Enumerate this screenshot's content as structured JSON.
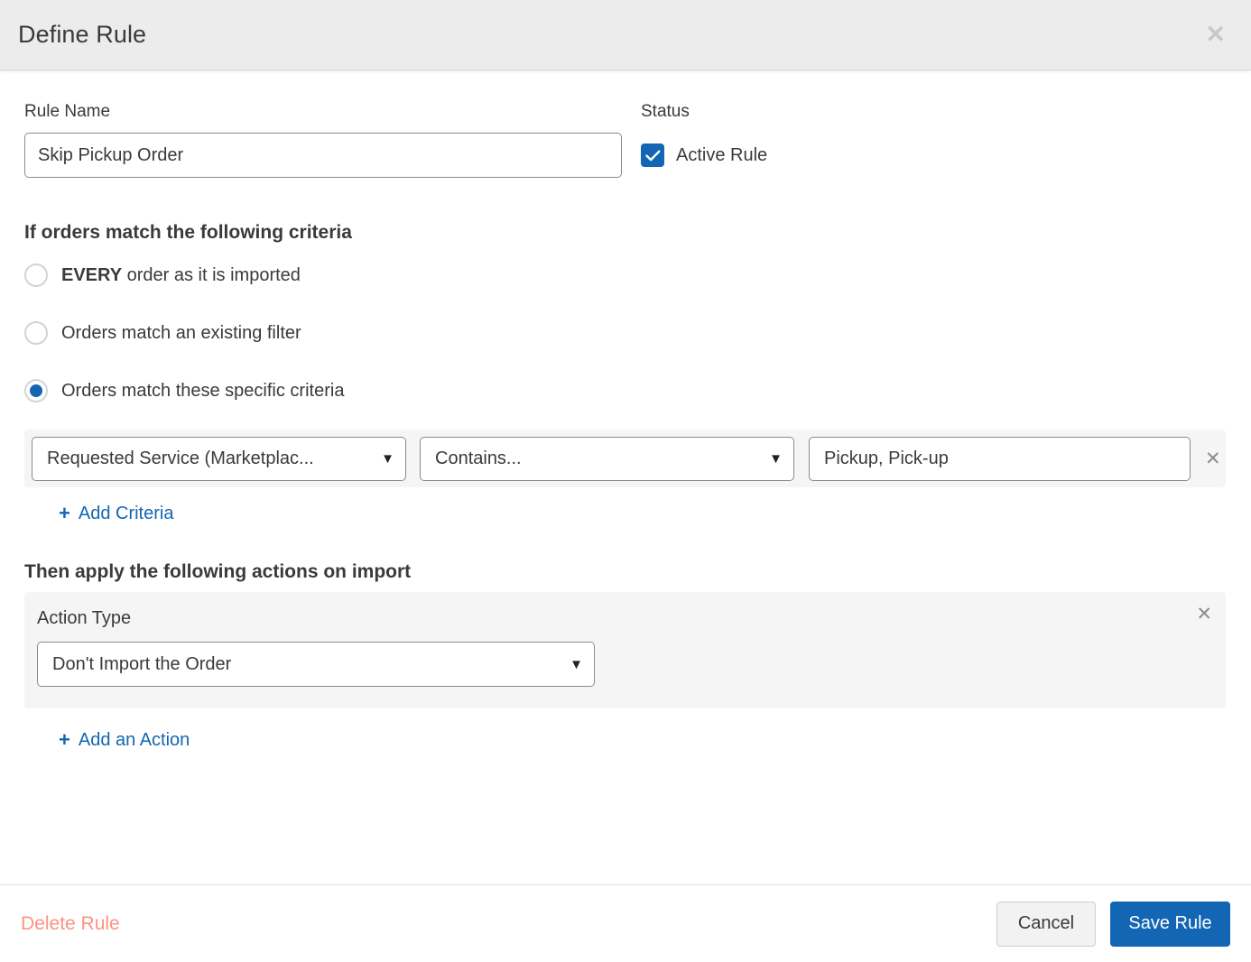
{
  "header": {
    "title": "Define Rule",
    "close_icon": "close-icon",
    "close_glyph": "✕"
  },
  "rule_name": {
    "label": "Rule Name",
    "value": "Skip Pickup Order",
    "placeholder": "Rule Name"
  },
  "status": {
    "label": "Status",
    "checkbox_label": "Active Rule",
    "checked": true
  },
  "criteria": {
    "heading": "If orders match the following criteria",
    "options": [
      {
        "label_bold": "EVERY",
        "label_rest": " order as it is imported",
        "selected": false
      },
      {
        "label_bold": "",
        "label_rest": "Orders match an existing filter",
        "selected": false
      },
      {
        "label_bold": "",
        "label_rest": "Orders match these specific criteria",
        "selected": true
      }
    ],
    "rows": [
      {
        "field": "Requested Service (Marketplac...",
        "operator": "Contains...",
        "value": "Pickup, Pick-up",
        "value_placeholder": "Value",
        "remove_glyph": "✕"
      }
    ],
    "add_label": "Add Criteria",
    "add_plus": "+"
  },
  "actions": {
    "heading": "Then apply the following actions on import",
    "action_type_label": "Action Type",
    "action_type_value": "Don't Import the Order",
    "remove_glyph": "✕",
    "add_label": "Add an Action",
    "add_plus": "+"
  },
  "footer": {
    "delete_label": "Delete Rule",
    "cancel_label": "Cancel",
    "save_label": "Save Rule"
  },
  "icons": {
    "caret_down": "▼",
    "checkmark": "check-icon"
  },
  "colors": {
    "accent_blue": "#1266b3",
    "delete_coral": "#fb9382",
    "header_bg": "#ececec",
    "panel_bg": "#f5f5f5"
  }
}
